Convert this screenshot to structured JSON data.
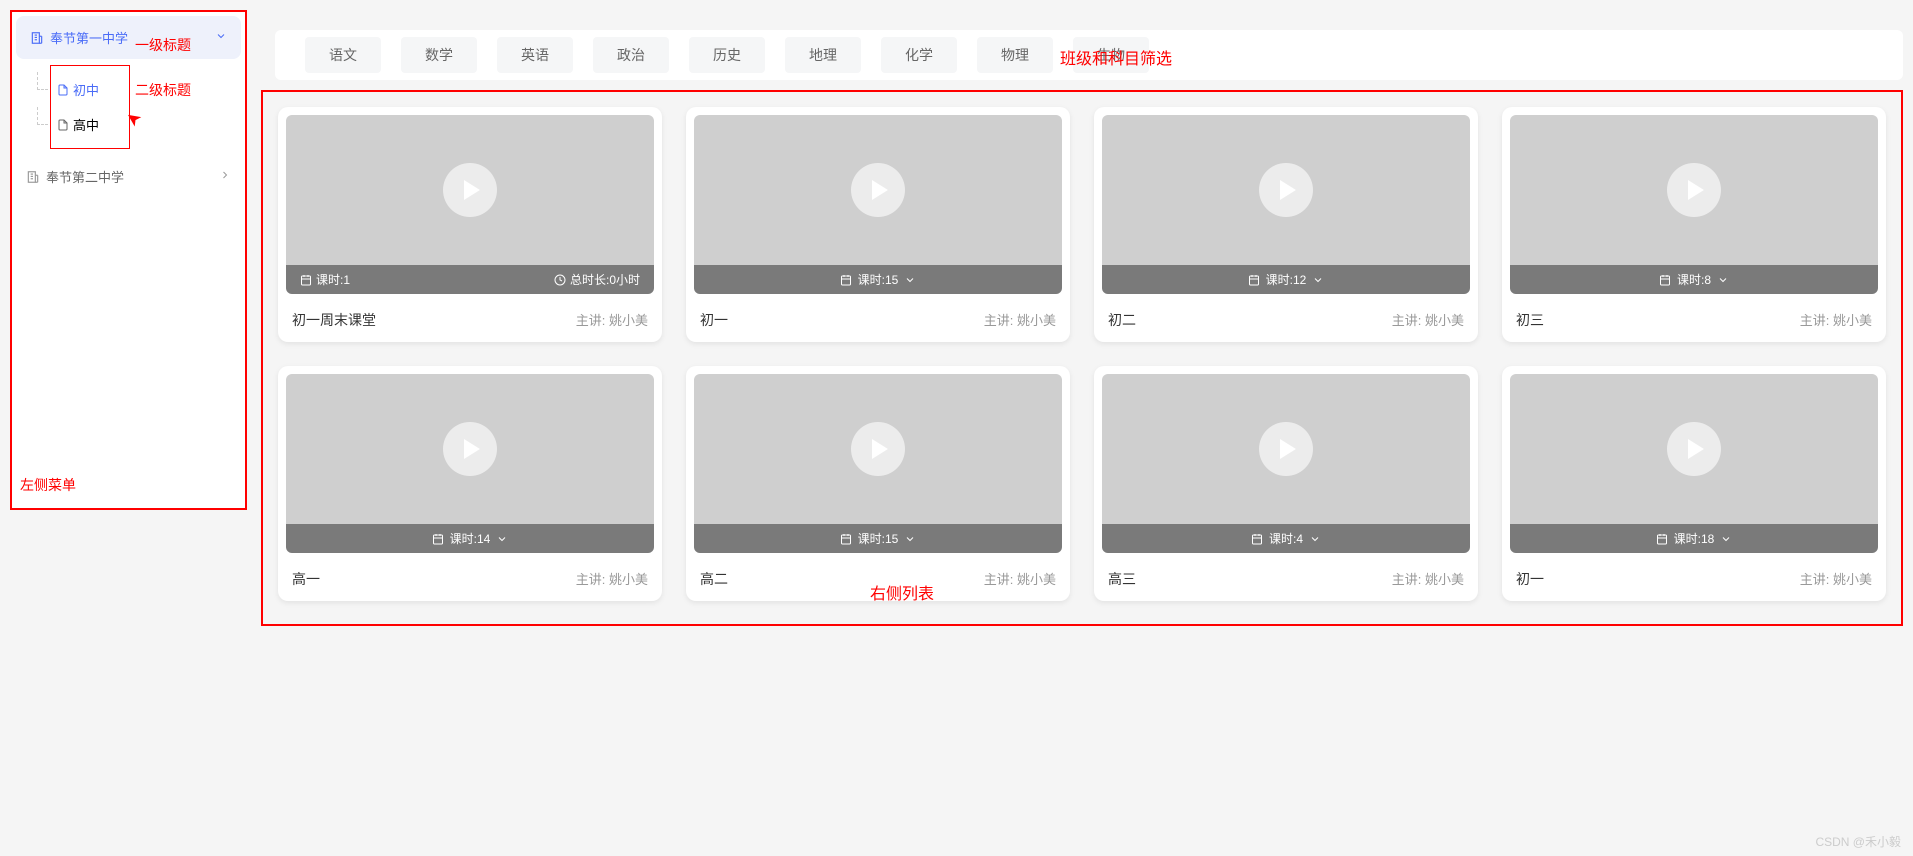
{
  "annotations": {
    "level1": "一级标题",
    "level2": "二级标题",
    "leftMenu": "左侧菜单",
    "filter": "班级和科目筛选",
    "rightList": "右侧列表"
  },
  "sidebar": {
    "items": [
      {
        "label": "奉节第一中学",
        "active": true,
        "children": [
          {
            "label": "初中",
            "active": true
          },
          {
            "label": "高中",
            "active": false
          }
        ]
      },
      {
        "label": "奉节第二中学",
        "active": false
      }
    ]
  },
  "filters": {
    "subjects": [
      "语文",
      "数学",
      "英语",
      "政治",
      "历史",
      "地理",
      "化学",
      "物理",
      "生物"
    ]
  },
  "lessonsLabelPrefix": "课时:",
  "durationLabelPrefix": "总时长:",
  "teacherLabelPrefix": "主讲: ",
  "cards": [
    {
      "title": "初一周末课堂",
      "lessons": "1",
      "duration": "0小时",
      "teacher": "姚小美",
      "hasDuration": true
    },
    {
      "title": "初一",
      "lessons": "15",
      "teacher": "姚小美",
      "hasDuration": false
    },
    {
      "title": "初二",
      "lessons": "12",
      "teacher": "姚小美",
      "hasDuration": false
    },
    {
      "title": "初三",
      "lessons": "8",
      "teacher": "姚小美",
      "hasDuration": false
    },
    {
      "title": "高一",
      "lessons": "14",
      "teacher": "姚小美",
      "hasDuration": false
    },
    {
      "title": "高二",
      "lessons": "15",
      "teacher": "姚小美",
      "hasDuration": false
    },
    {
      "title": "高三",
      "lessons": "4",
      "teacher": "姚小美",
      "hasDuration": false
    },
    {
      "title": "初一",
      "lessons": "18",
      "teacher": "姚小美",
      "hasDuration": false
    }
  ],
  "watermark": "CSDN @禾小毅"
}
